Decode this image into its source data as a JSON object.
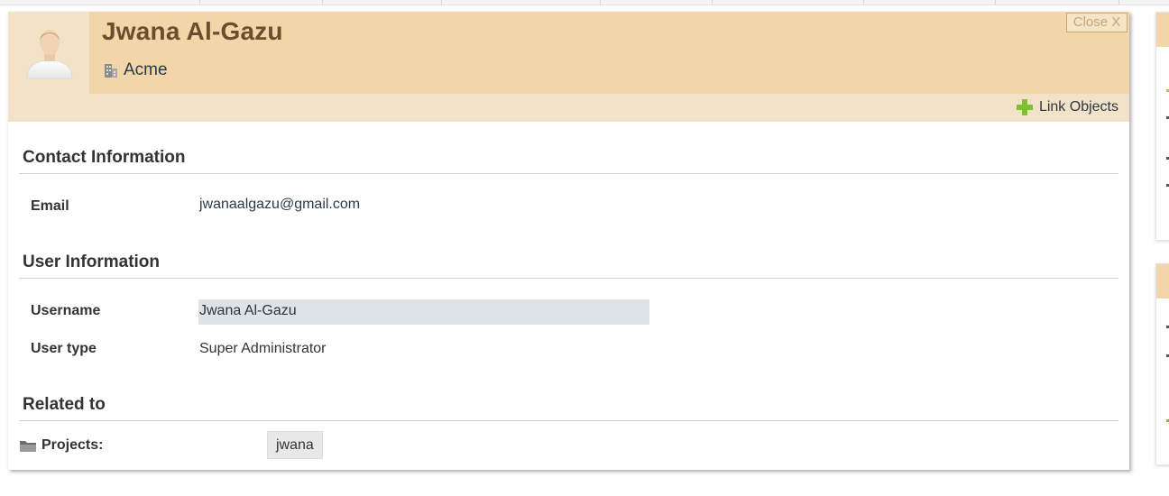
{
  "contact": {
    "name": "Jwana Al-Gazu",
    "company": "Acme",
    "close_label": "Close  X",
    "link_objects_label": "Link Objects"
  },
  "sections": {
    "contact_info": {
      "title": "Contact Information",
      "email_label": "Email",
      "email_value": "jwanaalgazu@gmail.com"
    },
    "user_info": {
      "title": "User Information",
      "username_label": "Username",
      "username_value": "Jwana Al-Gazu",
      "user_type_label": "User type",
      "user_type_value": "Super Administrator"
    },
    "related": {
      "title": "Related to",
      "projects_label": "Projects:",
      "projects": [
        "jwana"
      ]
    }
  },
  "colors": {
    "header_bg": "#f2d5a8",
    "subbar_bg": "#f2e3c8",
    "title_color": "#6b4e2e",
    "add_icon": "#7cc232"
  },
  "icons": [
    "user-avatar",
    "building-icon",
    "plus-icon",
    "folder-icon"
  ]
}
